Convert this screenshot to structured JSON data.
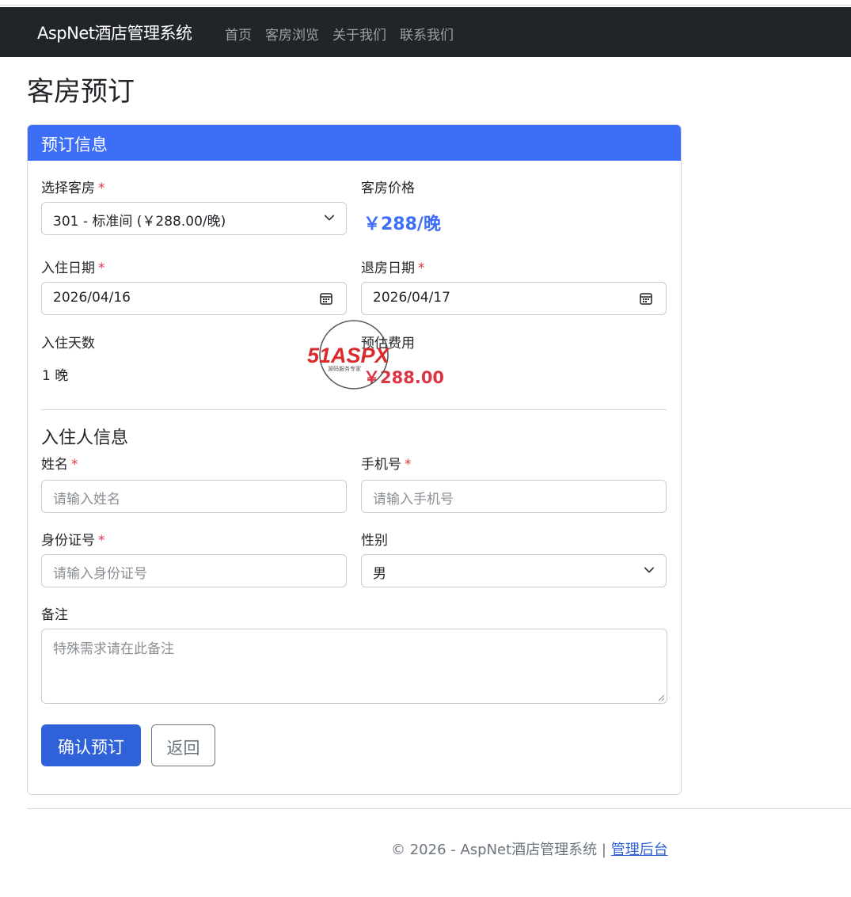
{
  "navbar": {
    "brand": "AspNet酒店管理系统",
    "links": [
      "首页",
      "客房浏览",
      "关于我们",
      "联系我们"
    ]
  },
  "page_title": "客房预订",
  "card": {
    "header": "预订信息",
    "room_select": {
      "label": "选择客房",
      "required": "*",
      "value": "301 - 标准间 (￥288.00/晚)"
    },
    "room_price": {
      "label": "客房价格",
      "value": "￥288/晚"
    },
    "checkin": {
      "label": "入住日期",
      "required": "*",
      "value": "2026/04/16"
    },
    "checkout": {
      "label": "退房日期",
      "required": "*",
      "value": "2026/04/17"
    },
    "nights": {
      "label": "入住天数",
      "value": "1 晚"
    },
    "estimate": {
      "label": "预估费用",
      "value": "￥288.00"
    },
    "guest_section": "入住人信息",
    "name": {
      "label": "姓名",
      "required": "*",
      "placeholder": "请输入姓名"
    },
    "phone": {
      "label": "手机号",
      "required": "*",
      "placeholder": "请输入手机号"
    },
    "idcard": {
      "label": "身份证号",
      "required": "*",
      "placeholder": "请输入身份证号"
    },
    "gender": {
      "label": "性别",
      "value": "男"
    },
    "remark": {
      "label": "备注",
      "placeholder": "特殊需求请在此备注"
    },
    "submit_label": "确认预订",
    "back_label": "返回"
  },
  "footer": {
    "text": "© 2026 - AspNet酒店管理系统 |",
    "link": "管理后台"
  },
  "watermark": {
    "logo": "51ASPX",
    "sub": "源码服务专家"
  },
  "colors": {
    "accent": "#3c6ff5",
    "danger": "#dc3545",
    "navbar": "#212529"
  },
  "icons": [
    "chevron-down-icon",
    "calendar-icon"
  ]
}
